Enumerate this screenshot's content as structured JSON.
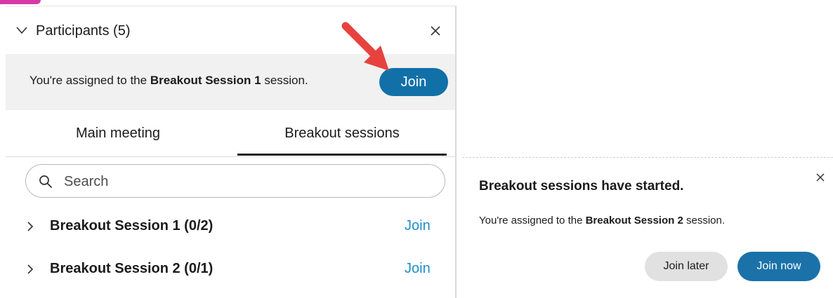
{
  "colors": {
    "accent_blue": "#1170a8",
    "link_blue": "#1d8fc9",
    "annotation_red": "#e8423f",
    "corner_magenta": "#d63aa8"
  },
  "panel": {
    "title": "Participants (5)",
    "collapse_icon": "chevron-down-icon",
    "close_icon": "close-icon",
    "assignment": {
      "prefix": "You're assigned to the ",
      "session": "Breakout Session 1",
      "suffix": " session.",
      "join_label": "Join"
    },
    "tabs": [
      {
        "label": "Main meeting",
        "active": false
      },
      {
        "label": "Breakout sessions",
        "active": true
      }
    ],
    "search": {
      "placeholder": "Search",
      "value": ""
    },
    "sessions": [
      {
        "label": "Breakout Session 1 (0/2)",
        "join_label": "Join"
      },
      {
        "label": "Breakout Session 2 (0/1)",
        "join_label": "Join"
      }
    ]
  },
  "toast": {
    "title": "Breakout sessions have started.",
    "message": {
      "prefix": "You're assigned to the ",
      "session": "Breakout Session 2",
      "suffix": " session."
    },
    "join_later_label": "Join later",
    "join_now_label": "Join now"
  }
}
